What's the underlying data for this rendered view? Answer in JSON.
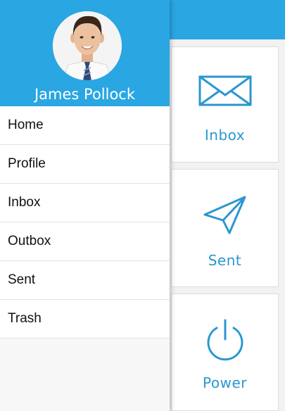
{
  "colors": {
    "accent": "#2aa6e2",
    "icon": "#2a97cf"
  },
  "profile": {
    "name": "James Pollock"
  },
  "drawer": {
    "items": [
      {
        "label": "Home"
      },
      {
        "label": "Profile"
      },
      {
        "label": "Inbox"
      },
      {
        "label": "Outbox"
      },
      {
        "label": "Sent"
      },
      {
        "label": "Trash"
      }
    ]
  },
  "tiles": {
    "inbox": {
      "label": "Inbox",
      "icon": "envelope-icon"
    },
    "sent": {
      "label": "Sent",
      "icon": "paper-plane-icon"
    },
    "power": {
      "label": "Power",
      "icon": "power-icon"
    }
  }
}
